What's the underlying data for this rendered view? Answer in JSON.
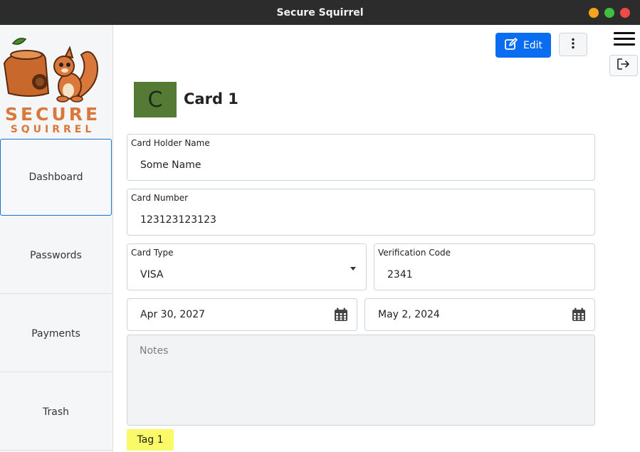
{
  "window": {
    "title": "Secure Squirrel"
  },
  "logo": {
    "line1": "SECURE",
    "line2": "SQUIRREL"
  },
  "sidebar": {
    "items": [
      {
        "label": "Dashboard"
      },
      {
        "label": "Passwords"
      },
      {
        "label": "Payments"
      },
      {
        "label": "Trash"
      }
    ]
  },
  "toolbar": {
    "edit_label": "Edit"
  },
  "card": {
    "avatar_letter": "C",
    "title": "Card 1",
    "holder_label": "Card Holder Name",
    "holder_value": "Some Name",
    "number_label": "Card Number",
    "number_value": "123123123123",
    "type_label": "Card Type",
    "type_value": "VISA",
    "cvv_label": "Verification Code",
    "cvv_value": "2341",
    "expiry_value": "Apr 30, 2027",
    "issue_value": "May 2, 2024",
    "notes_placeholder": "Notes",
    "tags": [
      "Tag 1"
    ]
  },
  "colors": {
    "accent": "#0a6cf0",
    "avatar_bg": "#557a36",
    "tag_bg": "#fafa68",
    "logo_orange": "#d9783a"
  },
  "icons": [
    "edit-icon",
    "more-vertical-icon",
    "hamburger-icon",
    "logout-icon",
    "calendar-icon",
    "caret-down-icon",
    "close-window-icon",
    "minimize-window-icon",
    "maximize-window-icon"
  ]
}
